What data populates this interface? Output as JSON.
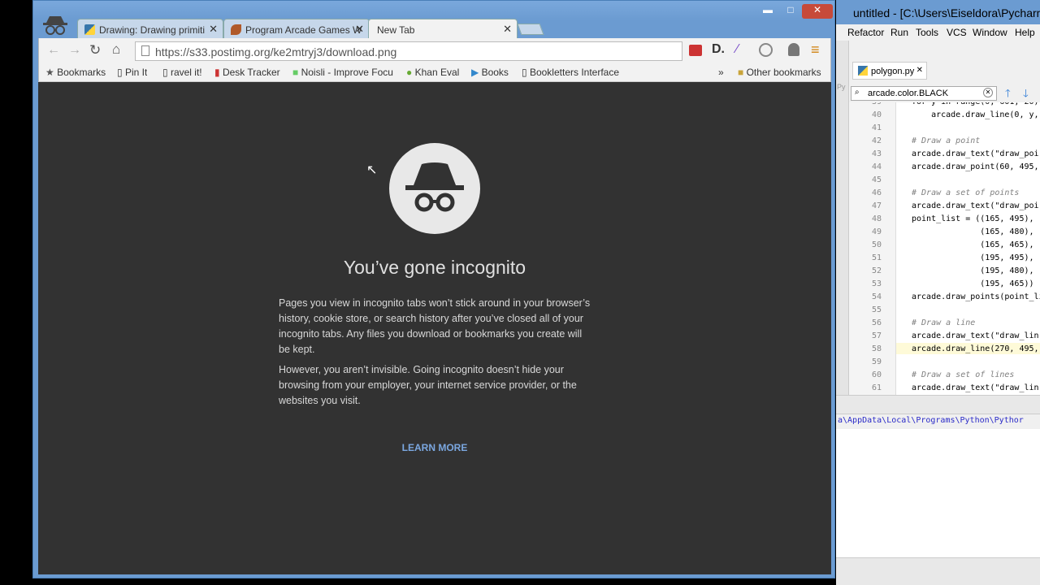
{
  "browser": {
    "tabs": [
      {
        "label": "Drawing: Drawing primiti"
      },
      {
        "label": "Program Arcade Games W"
      },
      {
        "label": "New Tab"
      }
    ],
    "url": "https://s33.postimg.org/ke2mtryj3/download.png",
    "bookmarks": [
      "Bookmarks",
      "Pin It",
      "ravel it!",
      "Desk Tracker",
      "Noisli - Improve Focu",
      "Khan Eval",
      "Books",
      "Bookletters Interface"
    ],
    "overflow": "»",
    "other_bookmarks": "Other bookmarks",
    "window_controls": {
      "min": "▬",
      "max": "□",
      "close": "✕"
    }
  },
  "incognito": {
    "title": "You’ve gone incognito",
    "para1": "Pages you view in incognito tabs won’t stick around in your browser’s history, cookie store, or search history after you’ve closed all of your incognito tabs. Any files you download or bookmarks you create will be kept.",
    "para2": "However, you aren’t invisible. Going incognito doesn’t hide your browsing from your employer, your internet service provider, or the websites you visit.",
    "learn_more": "LEARN MORE"
  },
  "ide": {
    "title": "untitled - [C:\\Users\\Eiseldora\\Pycharm",
    "menu": [
      "Refactor",
      "Run",
      "Tools",
      "VCS",
      "Window",
      "Help"
    ],
    "file_tab": "polygon.py",
    "side_label": "Py",
    "search_value": "arcade.color.BLACK",
    "code_lines": [
      {
        "n": "39",
        "t": "for y in range(0, 601, 20):"
      },
      {
        "n": "40",
        "t": "    arcade.draw_line(0, y,"
      },
      {
        "n": "41",
        "t": ""
      },
      {
        "n": "42",
        "t": "# Draw a point"
      },
      {
        "n": "43",
        "t": "arcade.draw_text(\"draw_poi"
      },
      {
        "n": "44",
        "t": "arcade.draw_point(60, 495,"
      },
      {
        "n": "45",
        "t": ""
      },
      {
        "n": "46",
        "t": "# Draw a set of points"
      },
      {
        "n": "47",
        "t": "arcade.draw_text(\"draw_poi"
      },
      {
        "n": "48",
        "t": "point_list = ((165, 495),"
      },
      {
        "n": "49",
        "t": "              (165, 480),"
      },
      {
        "n": "50",
        "t": "              (165, 465),"
      },
      {
        "n": "51",
        "t": "              (195, 495),"
      },
      {
        "n": "52",
        "t": "              (195, 480),"
      },
      {
        "n": "53",
        "t": "              (195, 465))"
      },
      {
        "n": "54",
        "t": "arcade.draw_points(point_li"
      },
      {
        "n": "55",
        "t": ""
      },
      {
        "n": "56",
        "t": "# Draw a line"
      },
      {
        "n": "57",
        "t": "arcade.draw_text(\"draw_lin"
      },
      {
        "n": "58",
        "t": "arcade.draw_line(270, 495,"
      },
      {
        "n": "59",
        "t": ""
      },
      {
        "n": "60",
        "t": "# Draw a set of lines"
      },
      {
        "n": "61",
        "t": "arcade.draw_text(\"draw_lin"
      }
    ],
    "console_path": "a\\AppData\\Local\\Programs\\Python\\Pythor"
  }
}
